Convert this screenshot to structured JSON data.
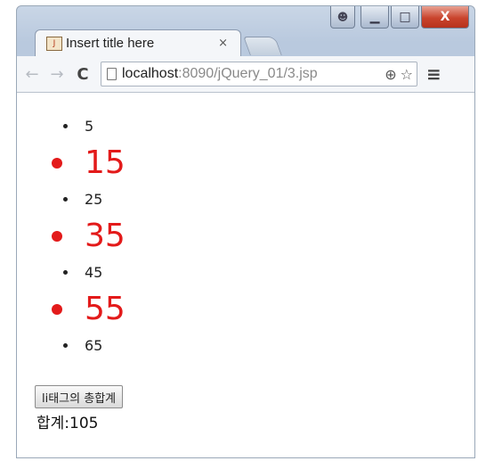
{
  "window": {
    "user_icon": "person-icon",
    "minimize": "▁",
    "maximize": "□",
    "close": "X"
  },
  "tab": {
    "title": "Insert title here",
    "close": "×",
    "favicon": "jsp-file-icon"
  },
  "toolbar": {
    "back": "←",
    "forward": "→",
    "reload": "C",
    "url_host": "localhost",
    "url_path": ":8090/jQuery_01/3.jsp",
    "zoom": "⊕",
    "star": "☆",
    "menu": "≡"
  },
  "list": {
    "items": [
      "5",
      "15",
      "25",
      "35",
      "45",
      "55",
      "65"
    ],
    "highlight_color": "#e31a1a"
  },
  "button": {
    "label": "li태그의 총합계"
  },
  "result": {
    "text": "합계:105"
  }
}
